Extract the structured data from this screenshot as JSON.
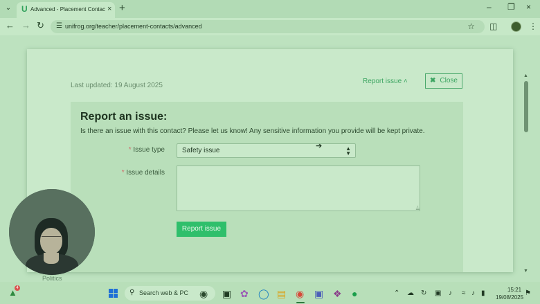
{
  "browser": {
    "tab_title": "Advanced - Placement Contacts",
    "tab_favicon": "U",
    "url": "unifrog.org/teacher/placement-contacts/advanced",
    "icons": [
      "tab-list-icon",
      "close-icon",
      "new-tab-icon",
      "minimize-icon",
      "maximize-icon",
      "window-close-icon",
      "back-icon",
      "forward-icon",
      "reload-icon",
      "site-settings-icon",
      "bookmark-star-icon",
      "extensions-icon",
      "profile-avatar",
      "menu-icon"
    ]
  },
  "modal": {
    "last_updated": "Last updated: 19 August 2025",
    "report_toggle": "Report issue ˄",
    "close_label": "Close",
    "close_icon_glyph": "✖"
  },
  "issue_form": {
    "title": "Report an issue:",
    "description": "Is there an issue with this contact? Please let us know! Any sensitive information you provide will be kept private.",
    "type_label": "Issue type",
    "type_value": "Safety issue",
    "details_label": "Issue details",
    "details_value": "",
    "required_marker": "*",
    "submit_label": "Report issue"
  },
  "webcam": {
    "caption": "Politics"
  },
  "taskbar": {
    "search_placeholder": "Search web & PC",
    "widget_badge": "4",
    "time": "15:21",
    "date": "19/08/2025"
  },
  "colors": {
    "accent": "#2fbf6b",
    "link": "#3da562",
    "required": "#d06a6a"
  }
}
